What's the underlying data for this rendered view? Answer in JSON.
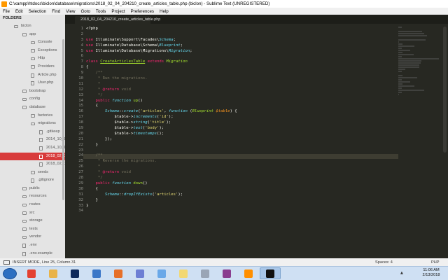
{
  "window": {
    "title": "C:\\xampp\\htdocs\\biclon\\database\\migrations\\2018_02_04_204210_create_articles_table.php (biclon) - Sublime Text (UNREGISTERED)"
  },
  "menu": [
    "File",
    "Edit",
    "Selection",
    "Find",
    "View",
    "Goto",
    "Tools",
    "Project",
    "Preferences",
    "Help"
  ],
  "sidebar": {
    "header": "FOLDERS",
    "items": [
      {
        "label": "biclon",
        "type": "folder",
        "depth": 0
      },
      {
        "label": "app",
        "type": "folder",
        "depth": 1
      },
      {
        "label": "Console",
        "type": "folder",
        "depth": 2
      },
      {
        "label": "Exceptions",
        "type": "folder",
        "depth": 2
      },
      {
        "label": "Http",
        "type": "folder",
        "depth": 2
      },
      {
        "label": "Providers",
        "type": "folder",
        "depth": 2
      },
      {
        "label": "Article.php",
        "type": "file",
        "depth": 2
      },
      {
        "label": "User.php",
        "type": "file",
        "depth": 2
      },
      {
        "label": "bootstrap",
        "type": "folder",
        "depth": 1
      },
      {
        "label": "config",
        "type": "folder",
        "depth": 1
      },
      {
        "label": "database",
        "type": "folder",
        "depth": 1
      },
      {
        "label": "factories",
        "type": "folder",
        "depth": 2
      },
      {
        "label": "migrations",
        "type": "folder",
        "depth": 2
      },
      {
        "label": ".gitkeep",
        "type": "file",
        "depth": 3
      },
      {
        "label": "2014_10_12_0000",
        "type": "file",
        "depth": 3
      },
      {
        "label": "2014_10_12_1000",
        "type": "file",
        "depth": 3
      },
      {
        "label": "2018_02_04_2042",
        "type": "file",
        "depth": 3,
        "selected": true
      },
      {
        "label": "2018_02_09_0542",
        "type": "file",
        "depth": 3
      },
      {
        "label": "seeds",
        "type": "folder",
        "depth": 2
      },
      {
        "label": ".gitignore",
        "type": "file",
        "depth": 2
      },
      {
        "label": "public",
        "type": "folder",
        "depth": 1
      },
      {
        "label": "resources",
        "type": "folder",
        "depth": 1
      },
      {
        "label": "routes",
        "type": "folder",
        "depth": 1
      },
      {
        "label": "src",
        "type": "folder",
        "depth": 1
      },
      {
        "label": "storage",
        "type": "folder",
        "depth": 1
      },
      {
        "label": "tests",
        "type": "folder",
        "depth": 1
      },
      {
        "label": "vendor",
        "type": "folder",
        "depth": 1
      },
      {
        "label": ".env",
        "type": "file",
        "depth": 1
      },
      {
        "label": ".env.example",
        "type": "file",
        "depth": 1
      }
    ]
  },
  "tab": {
    "label": "2018_02_04_204210_create_articles_table.php",
    "close": "×"
  },
  "editor": {
    "line_numbers": [
      "1",
      "2",
      "3",
      "4",
      "5",
      "6",
      "7",
      "8",
      "9",
      "10",
      "11",
      "12",
      "13",
      "14",
      "15",
      "16",
      "17",
      "18",
      "19",
      "20",
      "21",
      "22",
      "23",
      "24",
      "25",
      "26",
      "27",
      "28",
      "29",
      "30",
      "31",
      "32",
      "33",
      "34"
    ],
    "current_line": 25,
    "lines": [
      [
        [
          "<?php",
          ""
        ]
      ],
      [],
      [
        [
          "use",
          "kw"
        ],
        [
          " Illuminate\\Support\\Facades\\",
          ""
        ],
        [
          "Schema",
          "st"
        ],
        [
          ";",
          ""
        ]
      ],
      [
        [
          "use",
          "kw"
        ],
        [
          " Illuminate\\Database\\Schema\\",
          ""
        ],
        [
          "Blueprint",
          "st"
        ],
        [
          ";",
          ""
        ]
      ],
      [
        [
          "use",
          "kw"
        ],
        [
          " Illuminate\\Database\\Migrations\\",
          ""
        ],
        [
          "Migration",
          "st"
        ],
        [
          ";",
          ""
        ]
      ],
      [],
      [
        [
          "class",
          "kw"
        ],
        [
          " ",
          ""
        ],
        [
          "CreateArticlesTable",
          "cl"
        ],
        [
          " ",
          ""
        ],
        [
          "extends",
          "kw"
        ],
        [
          " ",
          ""
        ],
        [
          "Migration",
          "it"
        ]
      ],
      [
        [
          "{",
          ""
        ]
      ],
      [
        [
          "    /**",
          "cm"
        ]
      ],
      [
        [
          "     * Run the migrations.",
          "cm"
        ]
      ],
      [
        [
          "     *",
          "cm"
        ]
      ],
      [
        [
          "     * ",
          "cm"
        ],
        [
          "@return",
          "kw"
        ],
        [
          " void",
          "cm"
        ]
      ],
      [
        [
          "     */",
          "cm"
        ]
      ],
      [
        [
          "    ",
          ""
        ],
        [
          "public",
          "kw"
        ],
        [
          " ",
          ""
        ],
        [
          "function",
          "st"
        ],
        [
          " ",
          ""
        ],
        [
          "up",
          "fn"
        ],
        [
          "()",
          ""
        ]
      ],
      [
        [
          "    {",
          ""
        ]
      ],
      [
        [
          "        ",
          ""
        ],
        [
          "Schema",
          "st"
        ],
        [
          "::",
          ""
        ],
        [
          "create",
          "st"
        ],
        [
          "(",
          ""
        ],
        [
          "'articles'",
          "str"
        ],
        [
          ", ",
          ""
        ],
        [
          "function",
          "st"
        ],
        [
          " (",
          ""
        ],
        [
          "Blueprint",
          "it"
        ],
        [
          " ",
          ""
        ],
        [
          "$table",
          "pr"
        ],
        [
          ") {",
          ""
        ]
      ],
      [
        [
          "            $table->",
          ""
        ],
        [
          "increments",
          "st"
        ],
        [
          "(",
          ""
        ],
        [
          "'id'",
          "str"
        ],
        [
          ");",
          ""
        ]
      ],
      [
        [
          "            $table->",
          ""
        ],
        [
          "string",
          "st"
        ],
        [
          "(",
          ""
        ],
        [
          "'title'",
          "str"
        ],
        [
          ");",
          ""
        ]
      ],
      [
        [
          "            $table->",
          ""
        ],
        [
          "text",
          "st"
        ],
        [
          "(",
          ""
        ],
        [
          "'body'",
          "str"
        ],
        [
          ");",
          ""
        ]
      ],
      [
        [
          "            $table->",
          ""
        ],
        [
          "timestamps",
          "st"
        ],
        [
          "();",
          ""
        ]
      ],
      [
        [
          "        });",
          ""
        ]
      ],
      [
        [
          "    }",
          ""
        ]
      ],
      [],
      [
        [
          "    /**",
          "cm"
        ]
      ],
      [
        [
          "     * Reverse the migrations.",
          "cm"
        ]
      ],
      [
        [
          "     *",
          "cm"
        ]
      ],
      [
        [
          "     * ",
          "cm"
        ],
        [
          "@return",
          "kw"
        ],
        [
          " void",
          "cm"
        ]
      ],
      [
        [
          "     */",
          "cm"
        ]
      ],
      [
        [
          "    ",
          ""
        ],
        [
          "public",
          "kw"
        ],
        [
          " ",
          ""
        ],
        [
          "function",
          "st"
        ],
        [
          " ",
          ""
        ],
        [
          "down",
          "fn"
        ],
        [
          "()",
          ""
        ]
      ],
      [
        [
          "    {",
          ""
        ]
      ],
      [
        [
          "        ",
          ""
        ],
        [
          "Schema",
          "st"
        ],
        [
          "::",
          ""
        ],
        [
          "dropIfExists",
          "st"
        ],
        [
          "(",
          ""
        ],
        [
          "'articles'",
          "str"
        ],
        [
          ");",
          ""
        ]
      ],
      [
        [
          "    }",
          ""
        ]
      ],
      [
        [
          "}",
          ""
        ]
      ],
      []
    ]
  },
  "status": {
    "left": "INSERT MODE, Line 25, Column 31",
    "spaces": "Spaces: 4",
    "syntax": "PHP"
  },
  "taskbar": {
    "apps": [
      {
        "name": "chrome-icon",
        "color": "#e34133"
      },
      {
        "name": "folder-icon",
        "color": "#e8b34a"
      },
      {
        "name": "photoshop-icon",
        "color": "#0e2a5c"
      },
      {
        "name": "image-viewer-icon",
        "color": "#3c78c8"
      },
      {
        "name": "firefox-icon",
        "color": "#e6702a"
      },
      {
        "name": "discord-icon",
        "color": "#6d7fd4"
      },
      {
        "name": "paint-icon",
        "color": "#6aa8e8"
      },
      {
        "name": "notepad-icon",
        "color": "#f2d873"
      },
      {
        "name": "calculator-icon",
        "color": "#9aa5b5"
      },
      {
        "name": "winrar-icon",
        "color": "#8a3d8f"
      },
      {
        "name": "sublime-icon",
        "color": "#ff8f00"
      },
      {
        "name": "cmd-icon",
        "color": "#111111"
      }
    ],
    "active_index": 11,
    "time": "11:06 AM",
    "date": "2/13/2018"
  },
  "colors": {
    "accent_selected": "#d83b3b",
    "editor_bg": "#272822"
  }
}
